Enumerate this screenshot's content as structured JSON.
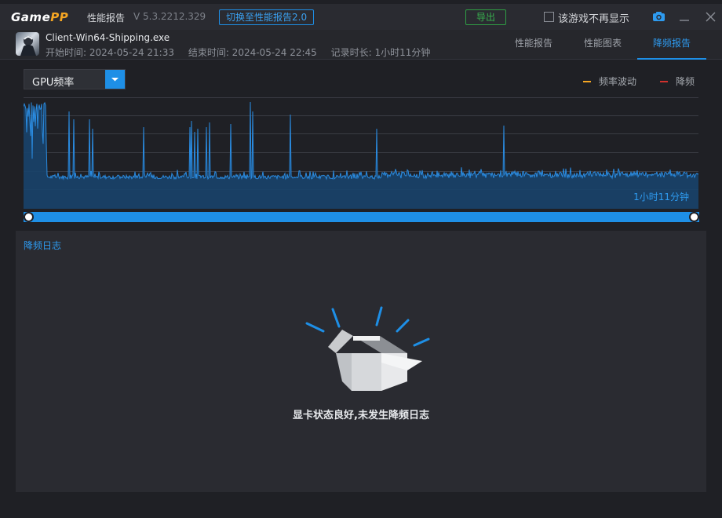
{
  "titlebar": {
    "logo_game": "Game",
    "logo_pp": "PP",
    "app_title": "性能报告",
    "version": "V 5.3.2212.329",
    "switch_button": "切换至性能报告2.0",
    "export_button": "导出",
    "no_show_label": "该游戏不再显示",
    "icons": [
      "camera-icon",
      "minimize-icon",
      "close-icon"
    ]
  },
  "header": {
    "game_name": "Client-Win64-Shipping.exe",
    "start_time": "开始时间: 2024-05-24 21:33",
    "end_time": "结束时间: 2024-05-24 22:45",
    "duration": "记录时长: 1小时11分钟",
    "tabs": [
      {
        "label": "性能报告",
        "active": false
      },
      {
        "label": "性能图表",
        "active": false
      },
      {
        "label": "降频报告",
        "active": true
      }
    ]
  },
  "chart": {
    "selector_value": "GPU频率",
    "legend": [
      {
        "label": "频率波动",
        "color": "#f5a623"
      },
      {
        "label": "降频",
        "color": "#d0312d"
      }
    ],
    "duration_label": "1小时11分钟",
    "colors": {
      "line": "#2a8be0",
      "fill": "#18436b",
      "accent": "#1e8fe6"
    }
  },
  "log": {
    "title": "降频日志",
    "empty_message": "显卡状态良好,未发生降频日志"
  }
}
